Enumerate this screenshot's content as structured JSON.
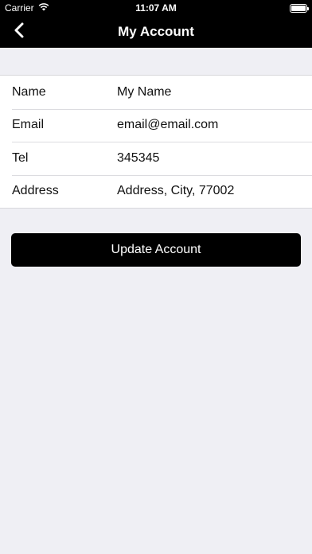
{
  "status_bar": {
    "carrier": "Carrier",
    "time": "11:07 AM",
    "wifi_icon": "wifi-icon",
    "battery_icon": "battery-icon"
  },
  "nav": {
    "title": "My Account",
    "back_icon": "chevron-left-icon"
  },
  "form": {
    "rows": [
      {
        "label": "Name",
        "value": "My Name"
      },
      {
        "label": "Email",
        "value": "email@email.com"
      },
      {
        "label": "Tel",
        "value": "345345"
      },
      {
        "label": "Address",
        "value": "Address, City, 77002"
      }
    ]
  },
  "actions": {
    "update_label": "Update Account"
  },
  "colors": {
    "nav_background": "#000000",
    "page_background": "#efeff4",
    "button_background": "#000000"
  }
}
